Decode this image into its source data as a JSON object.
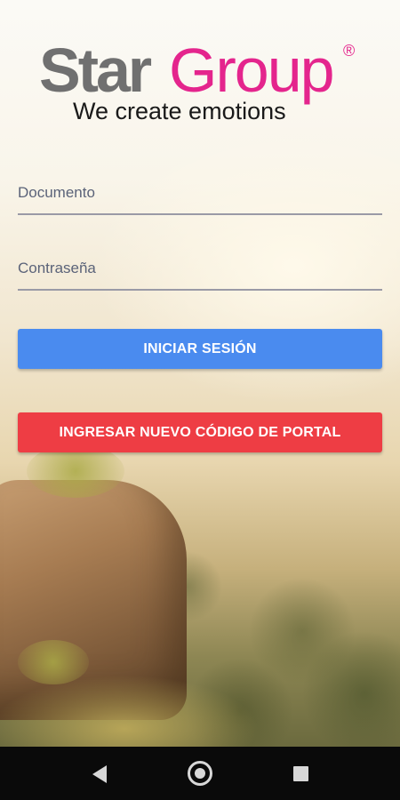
{
  "logo": {
    "brand_part1": "Star",
    "brand_part2": "Group",
    "registered_mark": "®",
    "tagline": "We create emotions",
    "colors": {
      "star": "#707070",
      "group": "#e4258d",
      "tagline": "#1a1a1a"
    }
  },
  "form": {
    "document_placeholder": "Documento",
    "document_value": "",
    "password_placeholder": "Contraseña",
    "password_value": ""
  },
  "buttons": {
    "login_label": "INICIAR SESIÓN",
    "portal_code_label": "INGRESAR NUEVO CÓDIGO DE PORTAL"
  },
  "colors": {
    "login_button": "#4a8bef",
    "portal_button": "#ee3d44",
    "nav_bar": "#0a0a0a"
  },
  "nav_bar": {
    "icons": [
      "back-icon",
      "home-icon",
      "recents-icon"
    ]
  }
}
